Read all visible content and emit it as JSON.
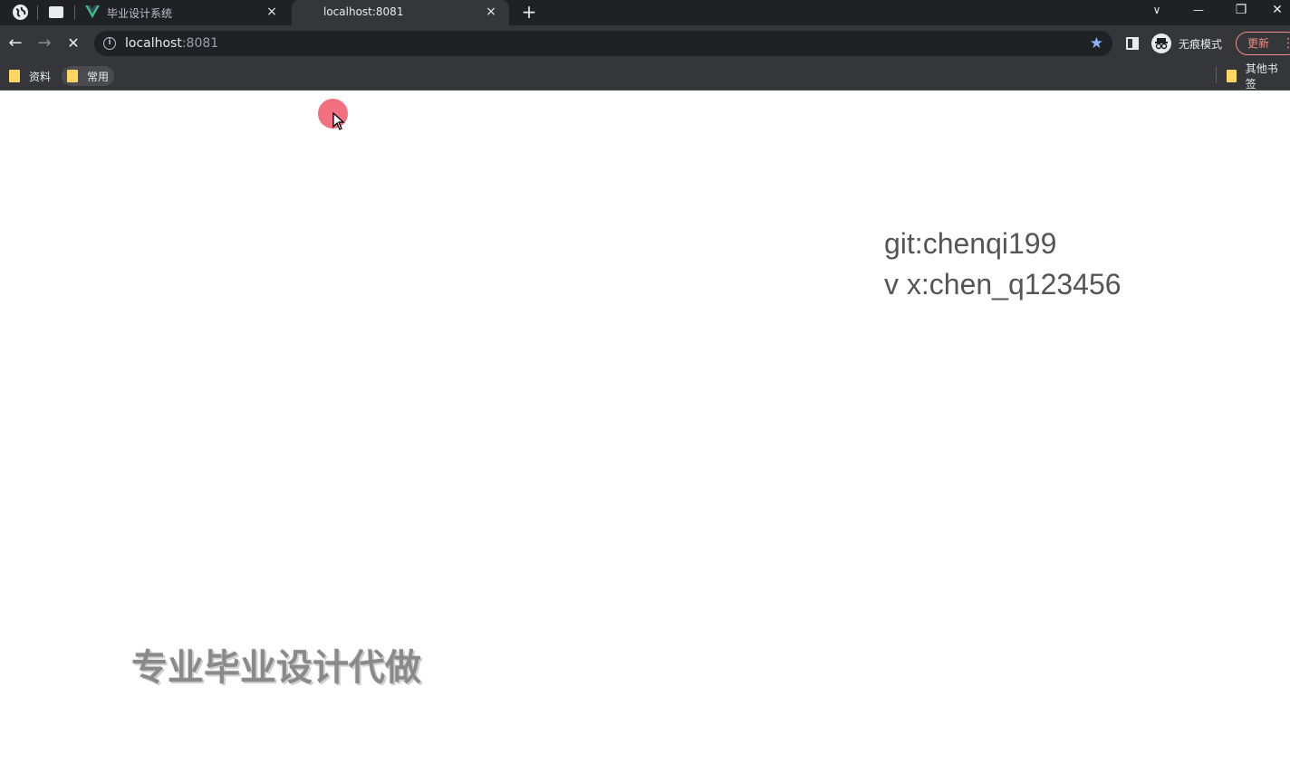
{
  "browser": {
    "tabs": [
      {
        "title": "毕业设计系统",
        "favicon": "vue-v-icon",
        "active": false
      },
      {
        "title": "localhost:8081",
        "favicon": "none",
        "active": true
      }
    ],
    "new_tab": "+",
    "window_controls": {
      "tab_search": "∨",
      "minimize": "—",
      "restore": "❐",
      "close": "✕"
    },
    "tab_close": "×",
    "nav": {
      "back": "←",
      "forward": "→",
      "stop": "✕"
    },
    "address": {
      "host": "localhost",
      "port": ":8081"
    },
    "incognito_label": "无痕模式",
    "update_label": "更新",
    "bookmarks": [
      {
        "label": "资料"
      },
      {
        "label": "常用"
      }
    ],
    "other_bookmarks": "其他书签",
    "colors": {
      "tabstrip": "#202124",
      "toolbar": "#35363a",
      "accent_star": "#8ab4f8",
      "folder": "#fdd663",
      "update": "#f28b82"
    }
  },
  "page": {
    "watermark": {
      "line1": "git:chenqi199",
      "line2": "v x:chen_q123456"
    },
    "promo_text": "专业毕业设计代做",
    "click_indicator_color": "#f05064"
  }
}
